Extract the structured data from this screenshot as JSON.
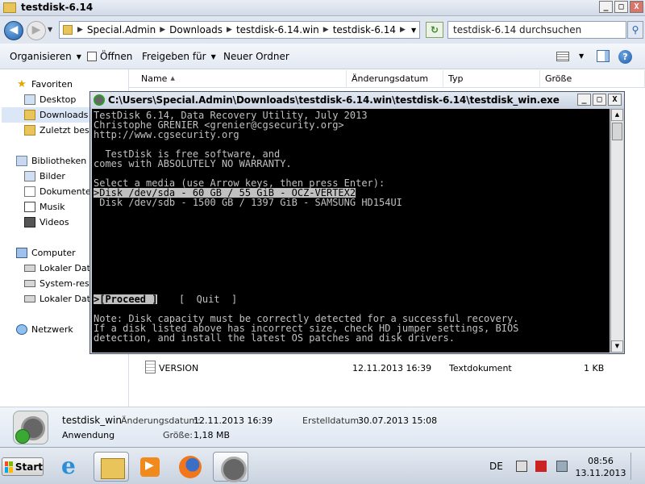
{
  "explorer": {
    "title": "testdisk-6.14",
    "nav_dropdown": "▼",
    "breadcrumb": [
      "Special.Admin",
      "Downloads",
      "testdisk-6.14.win",
      "testdisk-6.14"
    ],
    "search_placeholder": "testdisk-6.14 durchsuchen"
  },
  "window_controls": {
    "minimize": "_",
    "maximize": "□",
    "close": "X"
  },
  "toolbar": {
    "organize": "Organisieren",
    "open": "Öffnen",
    "share": "Freigeben für",
    "new_folder": "Neuer Ordner"
  },
  "nav_pane": {
    "favorites": "Favoriten",
    "desktop": "Desktop",
    "downloads": "Downloads",
    "recent": "Zuletzt besucht",
    "libraries": "Bibliotheken",
    "pictures": "Bilder",
    "documents": "Dokumente",
    "music": "Musik",
    "videos": "Videos",
    "computer": "Computer",
    "drive1": "Lokaler Datenträger",
    "drive2": "System-reserviert",
    "drive3": "Lokaler Datenträger",
    "network": "Netzwerk"
  },
  "file_list": {
    "columns": {
      "name": "Name",
      "date": "Änderungsdatum",
      "type": "Typ",
      "size": "Größe"
    },
    "sort_indicator": "▲",
    "row": {
      "name": "VERSION",
      "date": "12.11.2013 16:39",
      "type": "Textdokument",
      "size": "1 KB"
    }
  },
  "details": {
    "name": "testdisk_win",
    "modified_label": "Änderungsdatum:",
    "modified_value": "12.11.2013 16:39",
    "created_label": "Erstelldatum:",
    "created_value": "30.07.2013 15:08",
    "kind": "Anwendung",
    "size_label": "Größe:",
    "size_value": "1,18 MB"
  },
  "console": {
    "title": "C:\\Users\\Special.Admin\\Downloads\\testdisk-6.14.win\\testdisk-6.14\\testdisk_win.exe",
    "lines": {
      "l1": "TestDisk 6.14, Data Recovery Utility, July 2013",
      "l2": "Christophe GRENIER <grenier@cgsecurity.org>",
      "l3": "http://www.cgsecurity.org",
      "l4": "  TestDisk is free software, and",
      "l5": "comes with ABSOLUTELY NO WARRANTY.",
      "l6": "Select a media (use Arrow keys, then press Enter):",
      "l7": ">Disk /dev/sda - 60 GB / 55 GiB - OCZ-VERTEX2",
      "l8": " Disk /dev/sdb - 1500 GB / 1397 GiB - SAMSUNG HD154UI",
      "proceed": ">[Proceed ]",
      "quit": "[  Quit  ]",
      "n1": "Note: Disk capacity must be correctly detected for a successful recovery.",
      "n2": "If a disk listed above has incorrect size, check HD jumper settings, BIOS",
      "n3": "detection, and install the latest OS patches and disk drivers."
    }
  },
  "taskbar": {
    "start": "Start",
    "language": "DE",
    "time": "08:56",
    "date": "13.11.2013"
  },
  "colors": {
    "console_bg": "#000000",
    "console_text": "#c0c0c0",
    "selection_bg": "#dbe7f6",
    "start_logo": [
      "#f25022",
      "#7fba00",
      "#00a4ef",
      "#ffb900"
    ]
  }
}
